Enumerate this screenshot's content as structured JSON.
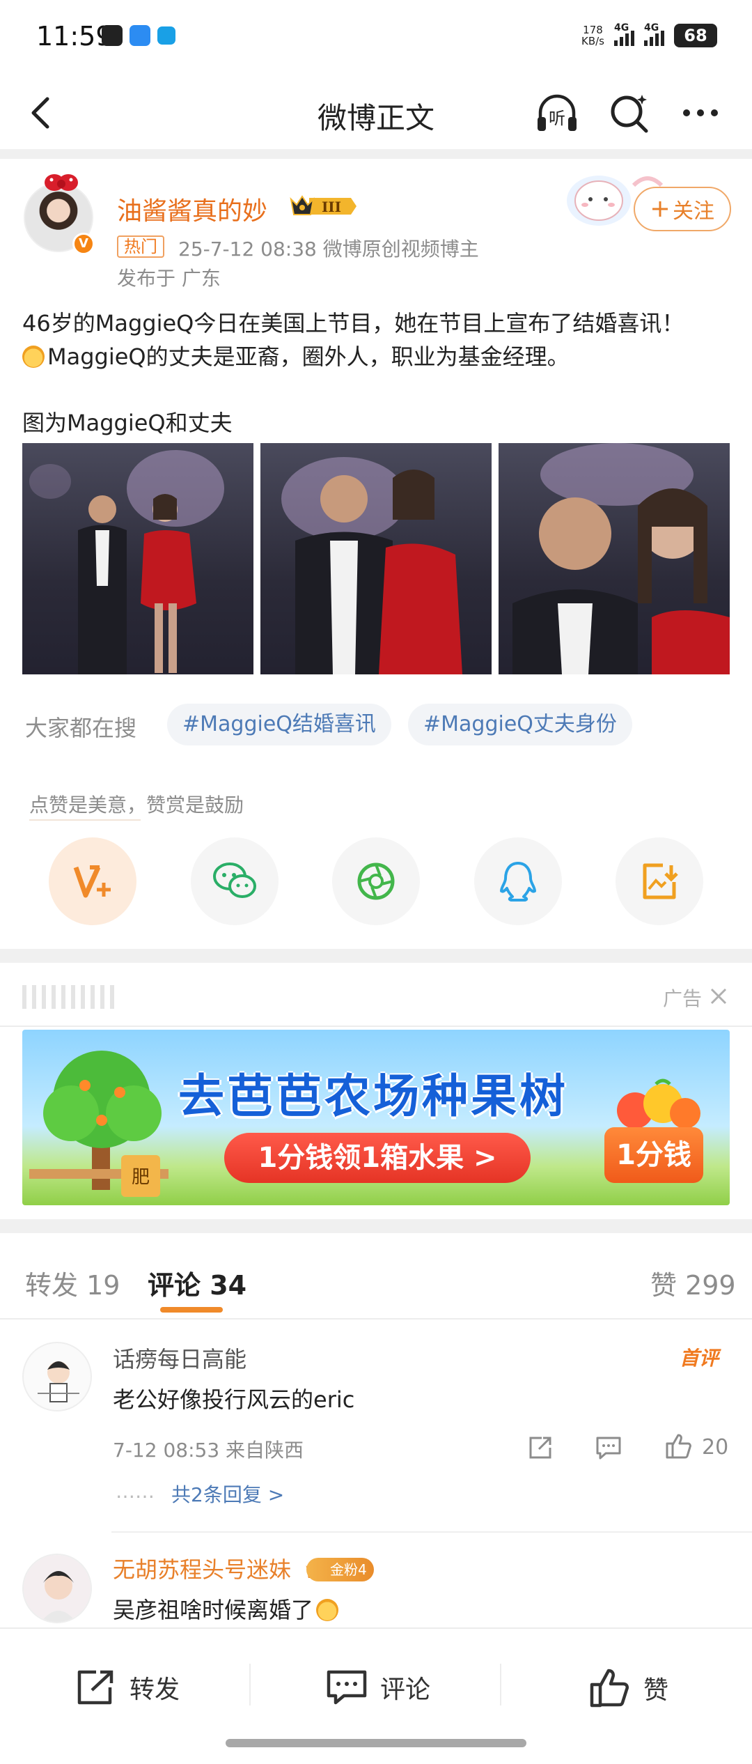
{
  "status_bar": {
    "time": "11:59",
    "net_speed_value": "178",
    "net_speed_unit": "KB/s",
    "sig1": "4G",
    "sig2": "4G",
    "battery": "68"
  },
  "header": {
    "title": "微博正文",
    "listen_label": "听"
  },
  "post": {
    "username": "油酱酱真的妙",
    "vip_level": "III",
    "hot_tag": "热门",
    "meta_line": "25-7-12 08:38   微博原创视频博主",
    "location": "发布于 广东",
    "follow_label": "关注",
    "text_line1": "46岁的MaggieQ今日在美国上节目，她在节目上宣布了结婚喜讯！",
    "text_line2": "MaggieQ的丈夫是亚裔，圈外人，职业为基金经理。",
    "caption": "图为MaggieQ和丈夫"
  },
  "search": {
    "label": "大家都在搜",
    "tags": [
      "#MaggieQ结婚喜讯",
      "#MaggieQ丈夫身份"
    ]
  },
  "appreciation_text": "点赞是美意，赞赏是鼓励",
  "share_icons": [
    "reward-icon",
    "wechat-icon",
    "moments-icon",
    "qq-icon",
    "save-image-icon"
  ],
  "ad": {
    "label": "广告",
    "title": "去芭芭农场种果树",
    "subtitle": "1分钱领1箱水果 >",
    "badge": "1分钱",
    "pot_label": "肥"
  },
  "tabs": {
    "repost": "转发 19",
    "comment": "评论 34",
    "like": "赞 299"
  },
  "comments": [
    {
      "name": "话痨每日高能",
      "badge": "首评",
      "text": "老公好像投行风云的eric",
      "meta": "7-12 08:53  来自陕西",
      "likes": "20",
      "dots": "……",
      "replies": "共2条回复 >"
    },
    {
      "name": "无胡苏程头号迷妹",
      "fan_badge": "金粉4",
      "text": "吴彦祖啥时候离婚了"
    }
  ],
  "bottom_bar": {
    "repost": "转发",
    "comment": "评论",
    "like": "赞"
  },
  "colors": {
    "accent": "#f08a2a",
    "link": "#4d7ab6",
    "username": "#e86f1c"
  }
}
